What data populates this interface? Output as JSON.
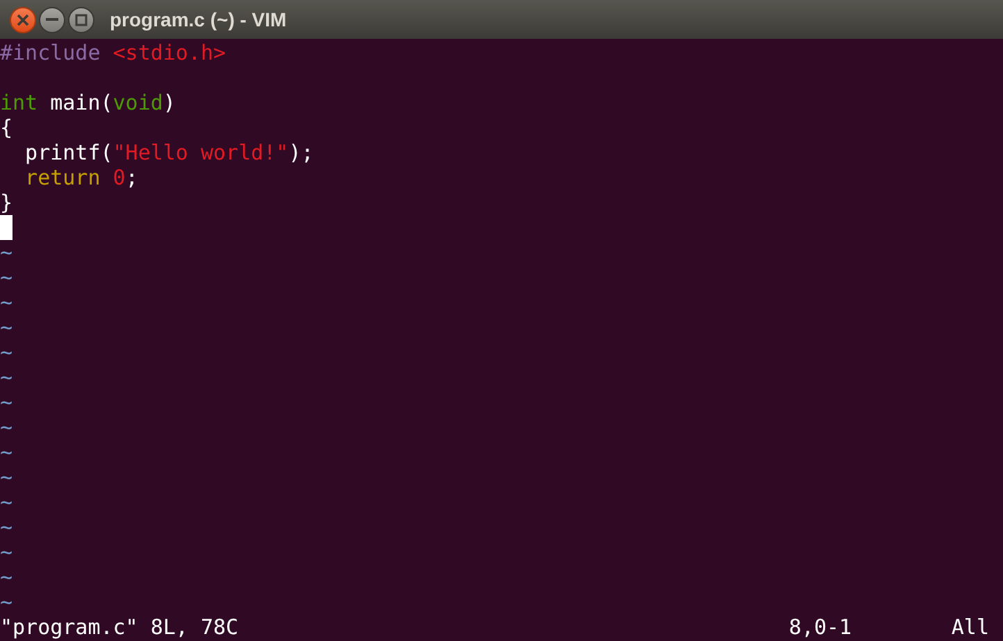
{
  "window": {
    "title": "program.c (~) - VIM"
  },
  "lines": [
    {
      "kind": "code",
      "tokens": [
        {
          "text": "#include",
          "kind": "preproc"
        },
        {
          "text": " <stdio.h>",
          "kind": "string"
        }
      ]
    },
    {
      "kind": "blank"
    },
    {
      "kind": "code",
      "tokens": [
        {
          "text": "int",
          "kind": "type"
        },
        {
          "text": " main(",
          "kind": "plain"
        },
        {
          "text": "void",
          "kind": "type"
        },
        {
          "text": ")",
          "kind": "plain"
        }
      ]
    },
    {
      "kind": "code",
      "tokens": [
        {
          "text": "{",
          "kind": "plain"
        }
      ]
    },
    {
      "kind": "code",
      "tokens": [
        {
          "text": "  printf(",
          "kind": "plain"
        },
        {
          "text": "\"Hello world!\"",
          "kind": "string"
        },
        {
          "text": ");",
          "kind": "plain"
        }
      ]
    },
    {
      "kind": "code",
      "tokens": [
        {
          "text": "  return",
          "kind": "keyword"
        },
        {
          "text": " 0",
          "kind": "string"
        },
        {
          "text": ";",
          "kind": "plain"
        }
      ]
    },
    {
      "kind": "code",
      "tokens": [
        {
          "text": "}",
          "kind": "plain"
        }
      ]
    },
    {
      "kind": "cursor"
    }
  ],
  "filler": [
    "~",
    "~",
    "~",
    "~",
    "~",
    "~",
    "~",
    "~",
    "~",
    "~",
    "~",
    "~",
    "~",
    "~",
    "~"
  ],
  "status_bar": {
    "message": "\"program.c\" 8L, 78C",
    "position": "8,0-1",
    "scroll": "All"
  }
}
